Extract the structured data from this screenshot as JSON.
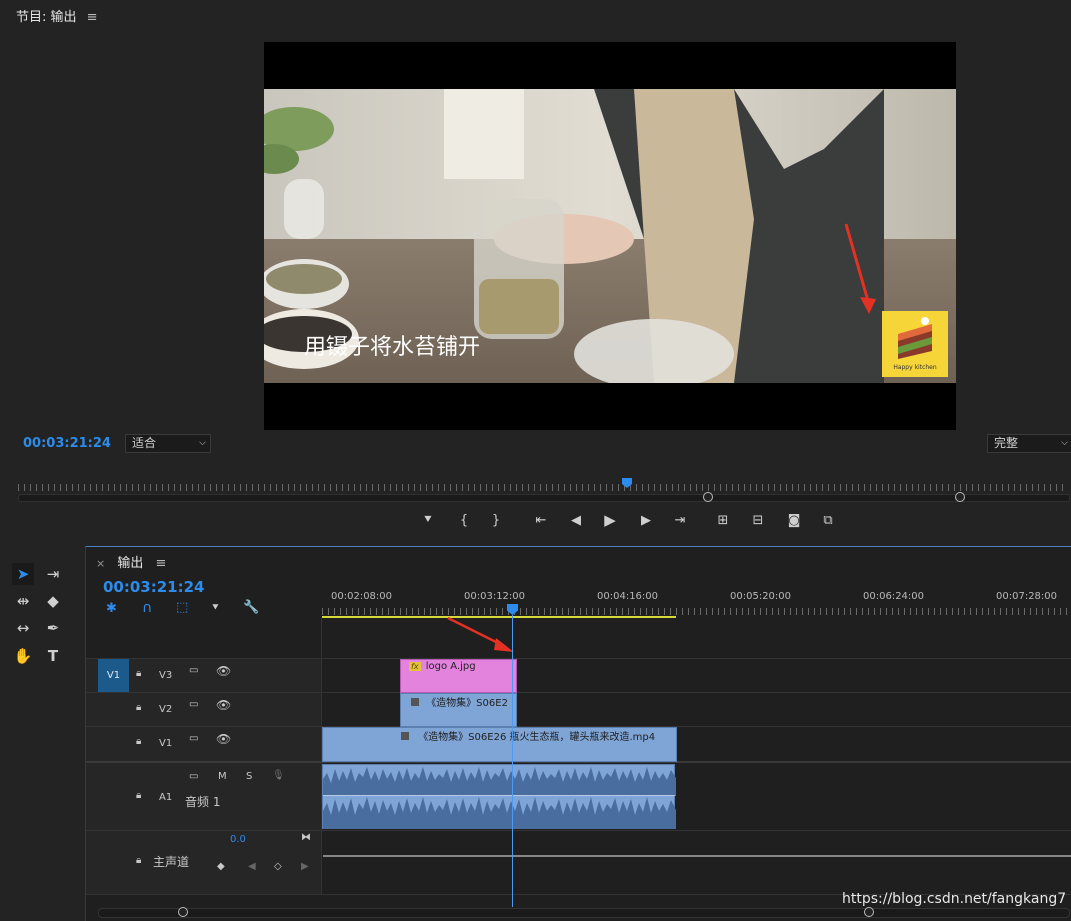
{
  "program_monitor": {
    "title": "节目: 输出",
    "timecode": "00:03:21:24",
    "zoom_select": "适合",
    "quality_select": "完整",
    "subtitle": "用镊子将水苔铺开",
    "logo_text": "Happy kitchen"
  },
  "transport_icons": [
    "marker-icon",
    "mark-in-icon",
    "mark-out-icon",
    "go-to-in-icon",
    "step-back-icon",
    "play-icon",
    "step-forward-icon",
    "go-to-out-icon",
    "lift-icon",
    "extract-icon",
    "export-frame-icon",
    "comparison-view-icon"
  ],
  "tools": [
    "selection-tool-icon",
    "track-select-icon",
    "ripple-edit-icon",
    "razor-icon",
    "slip-icon",
    "pen-icon",
    "hand-icon",
    "type-icon"
  ],
  "timeline": {
    "close_glyph": "×",
    "title": "输出",
    "timecode": "00:03:21:24",
    "ruler_labels": [
      "00:02:08:00",
      "00:03:12:00",
      "00:04:16:00",
      "00:05:20:00",
      "00:06:24:00",
      "00:07:28:00"
    ],
    "tracks": {
      "source_v1": "V1",
      "v3": "V3",
      "v2": "V2",
      "v1": "V1",
      "a1": "A1",
      "a1_name": "音频 1",
      "master_name": "主声道",
      "master_value": "0.0",
      "mute": "M",
      "solo": "S"
    },
    "clips": {
      "v3_clip": "logo A.jpg",
      "v2_clip": "《造物集》S06E2",
      "v1_clip": "《造物集》S06E26 瓶火生态瓶，罐头瓶来改造.mp4",
      "fx_badge": "fx"
    }
  },
  "watermark": "https://blog.csdn.net/fangkang7"
}
